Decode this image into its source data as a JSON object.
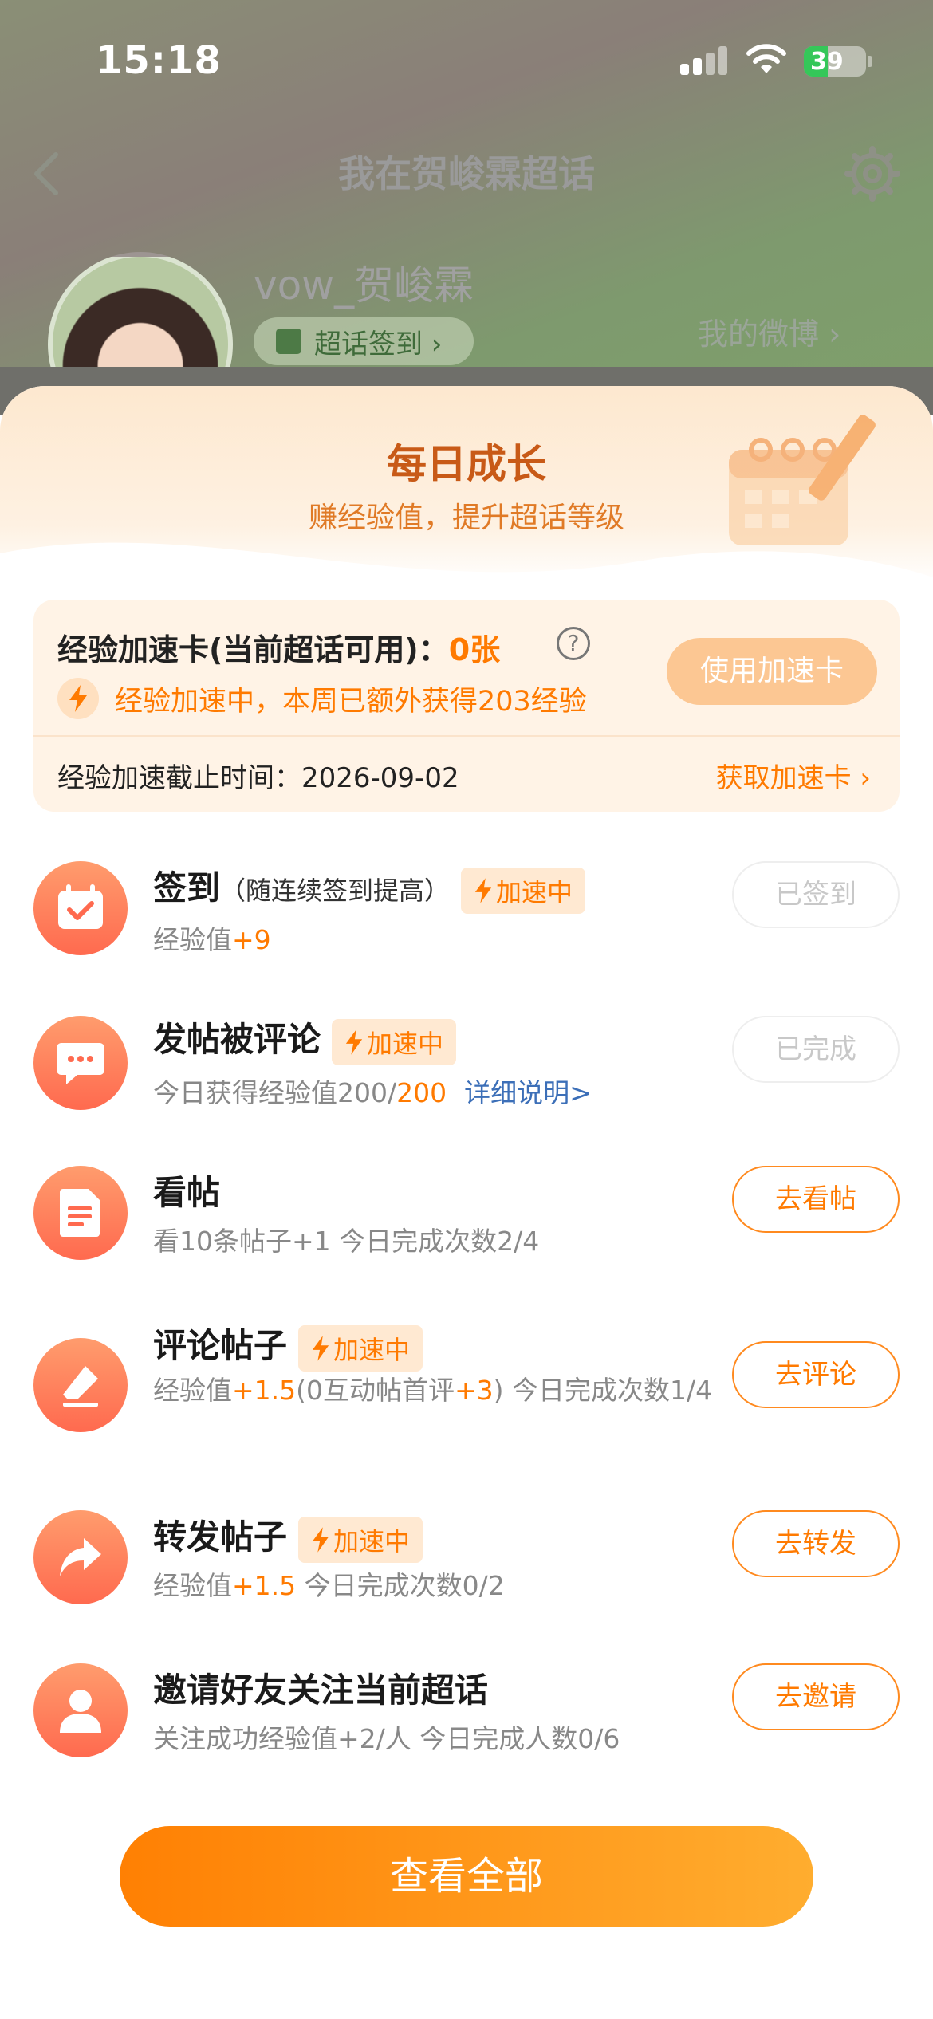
{
  "status_bar": {
    "time": "15:18",
    "battery": "39",
    "battery_level": 0.39
  },
  "background": {
    "title": "我在贺峻霖超话",
    "username": "vow_贺峻霖",
    "checkin_label": "超话签到 ›",
    "my_weibo": "我的微博 ›"
  },
  "sheet": {
    "title": "每日成长",
    "subtitle": "赚经验值，提升超话等级",
    "boost_card": {
      "title_prefix": "经验加速卡(当前超话可用)：",
      "count": "0张",
      "help": "?",
      "status": "经验加速中，本周已额外获得203经验",
      "use_button": "使用加速卡",
      "deadline": "经验加速截止时间：2026-09-02",
      "get_link": "获取加速卡 ›"
    },
    "boost_badge": "加速中",
    "tasks": [
      {
        "name": "签到",
        "note": "（随连续签到提高）",
        "desc_a": "经验值",
        "desc_hl": "+9",
        "button": "已签到"
      },
      {
        "name": "发帖被评论",
        "desc_a": "今日获得经验值200/",
        "desc_hl": "200",
        "link": "详细说明>",
        "button": "已完成"
      },
      {
        "name": "看帖",
        "desc_a": "看10条帖子+1   今日完成次数2/4",
        "button": "去看帖"
      },
      {
        "name": "评论帖子",
        "desc_a": "经验值",
        "desc_hl1": "+1.5",
        "desc_b": "(0互动帖首评",
        "desc_hl2": "+3",
        "desc_c": ")   今日完成次数1/4",
        "button": "去评论"
      },
      {
        "name": "转发帖子",
        "desc_a": "经验值",
        "desc_hl": "+1.5",
        "desc_b": "   今日完成次数0/2",
        "button": "去转发"
      },
      {
        "name": "邀请好友关注当前超话",
        "desc_a": "关注成功经验值+2/人   今日完成人数0/6",
        "button": "去邀请"
      }
    ],
    "view_all": "查看全部"
  },
  "colors": {
    "accent": "#ff7a00",
    "title": "#c85a17",
    "link": "#3c6fb8"
  },
  "icons": [
    "back-icon",
    "gear-icon",
    "calendar-check-icon",
    "bolt-icon",
    "help-icon",
    "chat-bubble-icon",
    "document-icon",
    "eraser-icon",
    "share-arrow-icon",
    "person-icon"
  ]
}
